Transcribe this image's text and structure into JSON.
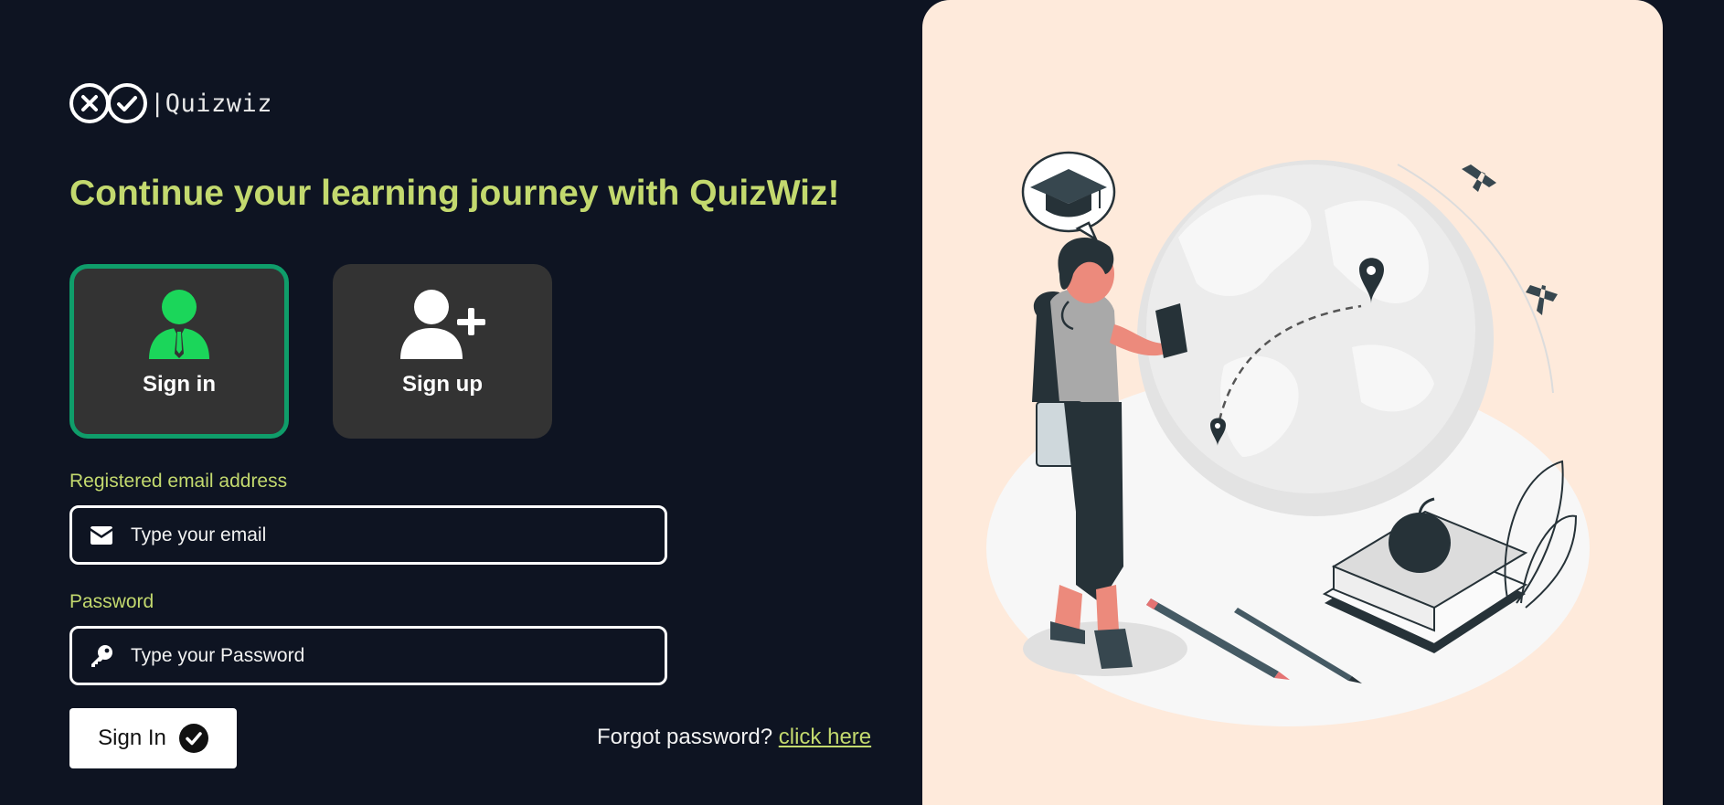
{
  "brand": {
    "name": "|Quizwiz"
  },
  "headline": "Continue your learning journey with QuizWiz!",
  "modes": [
    {
      "label": "Sign in",
      "icon": "user-tie-icon",
      "active": true
    },
    {
      "label": "Sign up",
      "icon": "user-plus-icon",
      "active": false
    }
  ],
  "form": {
    "email": {
      "label": "Registered email address",
      "placeholder": "Type your email",
      "value": "",
      "icon": "envelope-icon"
    },
    "password": {
      "label": "Password",
      "placeholder": "Type your Password",
      "value": "",
      "icon": "key-icon"
    },
    "submit_label": "Sign In",
    "forgot_text": "Forgot password?",
    "forgot_link": "click here"
  },
  "colors": {
    "background": "#0e1422",
    "accent": "#c3d96e",
    "active_border": "#0f9d6a",
    "signin_icon": "#1bd65a",
    "card": "#333333",
    "panel": "#feeadb"
  }
}
